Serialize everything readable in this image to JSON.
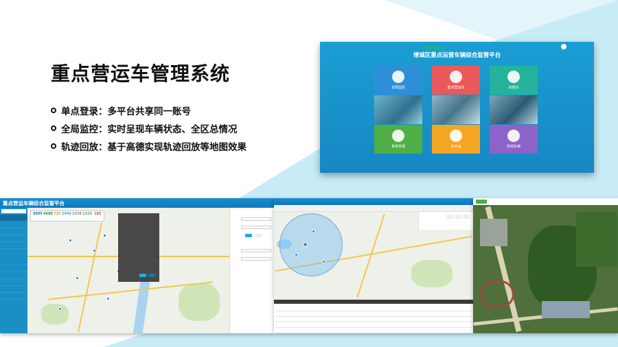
{
  "slide": {
    "title": "重点营运车管理系统",
    "bullets": [
      "全局监控：实时呈现车辆状态、全区总情况",
      "轨迹回放：基于高德实现轨迹回放等地图效果"
    ],
    "bullet_first": "单点登录：多平台共享同一账号"
  },
  "portal": {
    "title": "增城区重点运营车辆综合监管平台",
    "tiles": [
      {
        "label": "全局监控",
        "color": "#2e8fd8",
        "icon": "shield-icon"
      },
      {
        "label": "重点营运车",
        "color": "#ea5a5a",
        "icon": "bus-icon"
      },
      {
        "label": "出租车",
        "color": "#25b39b",
        "icon": "taxi-icon"
      },
      {
        "label": "系统管理",
        "color": "#4fae45",
        "icon": "house-icon"
      },
      {
        "label": "市平台",
        "color": "#f4a623",
        "icon": "dashboard-icon"
      },
      {
        "label": "驾培车辆",
        "color": "#8e63c9",
        "icon": "car-icon"
      }
    ]
  },
  "app1": {
    "title": "重点营运车辆综合监管平台",
    "sidebar_items": [
      "",
      "",
      "",
      "",
      "",
      "",
      "",
      "",
      "",
      "",
      ""
    ],
    "stats": [
      {
        "value": "8805",
        "color": "#2b74c8"
      },
      {
        "value": "4668",
        "color": "#1a9e4b"
      },
      {
        "value": "735",
        "color": "#f08a24"
      },
      {
        "value": "2949",
        "color": "#2bb0e8"
      },
      {
        "value": "1639",
        "color": "#888888"
      },
      {
        "value": "1314",
        "color": "#5aa06c"
      },
      {
        "value": "185",
        "color": "#e04a4a"
      }
    ]
  },
  "app2": {
    "tabs": [
      "",
      "",
      "",
      "",
      "",
      ""
    ]
  },
  "colors": {
    "accent": "#1787c3",
    "wedge": "#c8ecf6"
  }
}
